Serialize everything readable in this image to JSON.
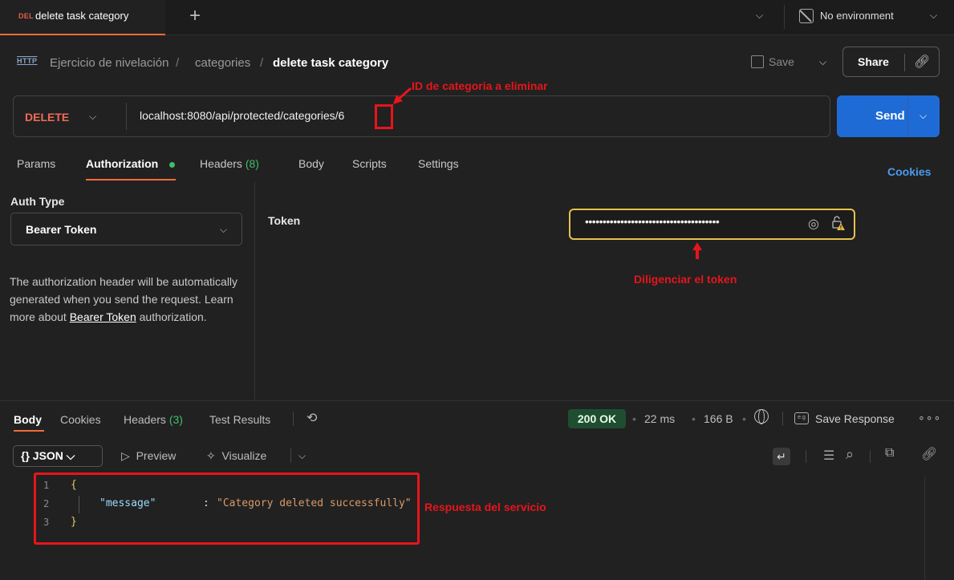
{
  "tab": {
    "method_badge": "DEL",
    "title": "delete task category",
    "new_tab": "+"
  },
  "environment": {
    "label": "No environment"
  },
  "breadcrumb": {
    "icon": "HTTP",
    "collection": "Ejercicio de nivelación",
    "separator": "/",
    "folder": "categories",
    "request": "delete task category"
  },
  "toolbar": {
    "save_label": "Save",
    "share_label": "Share"
  },
  "request": {
    "method": "DELETE",
    "url": "localhost:8080/api/protected/categories/6",
    "send_label": "Send"
  },
  "request_tabs": {
    "params": "Params",
    "authorization": "Authorization",
    "headers": "Headers",
    "headers_count": "(8)",
    "body": "Body",
    "scripts": "Scripts",
    "settings": "Settings",
    "cookies": "Cookies"
  },
  "auth": {
    "type_label": "Auth Type",
    "type_value": "Bearer Token",
    "description": "The authorization header will be automatically generated when you send the request. Learn more about",
    "description_link": "Bearer Token",
    "description_tail": "authorization.",
    "token_label": "Token",
    "token_masked": "••••••••••••••••••••••••••••••••••••••"
  },
  "annotations": {
    "id_note": "ID de categoria a eliminar",
    "token_note": "Diligenciar el token",
    "response_note": "Respuesta del servicio",
    "color": "#e6151b"
  },
  "response": {
    "tabs": {
      "body": "Body",
      "cookies": "Cookies",
      "headers": "Headers",
      "headers_count": "(3)",
      "tests": "Test Results"
    },
    "status": "200 OK",
    "time": "22 ms",
    "size": "166 B",
    "save_response": "Save Response",
    "format": "{} JSON",
    "preview": "Preview",
    "visualize": "Visualize",
    "lines": [
      "1",
      "2",
      "3"
    ],
    "brace_open": "{",
    "key": "\"message\"",
    "colon": ":",
    "value": "\"Category deleted successfully\"",
    "brace_close": "}"
  },
  "colors": {
    "accent_orange": "#f26b3a",
    "send_blue": "#1f6bd6",
    "status_green": "#1f4d30",
    "delete_red": "#ef6c57",
    "token_border": "#e8c04a"
  }
}
